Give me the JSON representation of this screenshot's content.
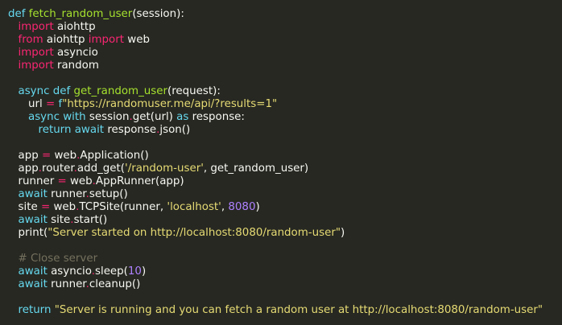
{
  "editor": {
    "theme_colors": {
      "background": "#272822",
      "keyword": "#f92672",
      "storage": "#66d9ef",
      "function": "#a6e22e",
      "string": "#e6db74",
      "number": "#ae81ff",
      "comment": "#75715e",
      "text": "#f8f8f2"
    },
    "lines": [
      {
        "indent": 0,
        "tokens": [
          [
            "st",
            "def"
          ],
          [
            "tx",
            " "
          ],
          [
            "fn",
            "fetch_random_user"
          ],
          [
            "tx",
            "(session):"
          ]
        ]
      },
      {
        "indent": 1,
        "tokens": [
          [
            "kw",
            "import"
          ],
          [
            "tx",
            " aiohttp"
          ]
        ]
      },
      {
        "indent": 1,
        "tokens": [
          [
            "kw",
            "from"
          ],
          [
            "tx",
            " aiohttp "
          ],
          [
            "kw",
            "import"
          ],
          [
            "tx",
            " web"
          ]
        ]
      },
      {
        "indent": 1,
        "tokens": [
          [
            "kw",
            "import"
          ],
          [
            "tx",
            " asyncio"
          ]
        ]
      },
      {
        "indent": 1,
        "tokens": [
          [
            "kw",
            "import"
          ],
          [
            "tx",
            " random"
          ]
        ]
      },
      {
        "indent": 0,
        "tokens": []
      },
      {
        "indent": 1,
        "tokens": [
          [
            "st",
            "async"
          ],
          [
            "tx",
            " "
          ],
          [
            "st",
            "def"
          ],
          [
            "tx",
            " "
          ],
          [
            "fn",
            "get_random_user"
          ],
          [
            "tx",
            "(request):"
          ]
        ]
      },
      {
        "indent": 2,
        "tokens": [
          [
            "tx",
            "url "
          ],
          [
            "op",
            "="
          ],
          [
            "tx",
            " "
          ],
          [
            "st",
            "f"
          ],
          [
            "str",
            "\"https://randomuser.me/api/?results=1\""
          ]
        ]
      },
      {
        "indent": 2,
        "tokens": [
          [
            "st",
            "async"
          ],
          [
            "tx",
            " "
          ],
          [
            "st",
            "with"
          ],
          [
            "tx",
            " session"
          ],
          [
            "op",
            "."
          ],
          [
            "tx",
            "get(url) "
          ],
          [
            "st",
            "as"
          ],
          [
            "tx",
            " response:"
          ]
        ]
      },
      {
        "indent": 3,
        "tokens": [
          [
            "st",
            "return"
          ],
          [
            "tx",
            " "
          ],
          [
            "st",
            "await"
          ],
          [
            "tx",
            " response"
          ],
          [
            "op",
            "."
          ],
          [
            "tx",
            "json()"
          ]
        ]
      },
      {
        "indent": 0,
        "tokens": []
      },
      {
        "indent": 1,
        "tokens": [
          [
            "tx",
            "app "
          ],
          [
            "op",
            "="
          ],
          [
            "tx",
            " web"
          ],
          [
            "op",
            "."
          ],
          [
            "tx",
            "Application()"
          ]
        ]
      },
      {
        "indent": 1,
        "tokens": [
          [
            "tx",
            "app"
          ],
          [
            "op",
            "."
          ],
          [
            "tx",
            "router"
          ],
          [
            "op",
            "."
          ],
          [
            "tx",
            "add_get("
          ],
          [
            "str",
            "'/random-user'"
          ],
          [
            "tx",
            ", get_random_user)"
          ]
        ]
      },
      {
        "indent": 1,
        "tokens": [
          [
            "tx",
            "runner "
          ],
          [
            "op",
            "="
          ],
          [
            "tx",
            " web"
          ],
          [
            "op",
            "."
          ],
          [
            "tx",
            "AppRunner(app)"
          ]
        ]
      },
      {
        "indent": 1,
        "tokens": [
          [
            "st",
            "await"
          ],
          [
            "tx",
            " runner"
          ],
          [
            "op",
            "."
          ],
          [
            "tx",
            "setup()"
          ]
        ]
      },
      {
        "indent": 1,
        "tokens": [
          [
            "tx",
            "site "
          ],
          [
            "op",
            "="
          ],
          [
            "tx",
            " web"
          ],
          [
            "op",
            "."
          ],
          [
            "tx",
            "TCPSite(runner, "
          ],
          [
            "str",
            "'localhost'"
          ],
          [
            "tx",
            ", "
          ],
          [
            "num",
            "8080"
          ],
          [
            "tx",
            ")"
          ]
        ]
      },
      {
        "indent": 1,
        "tokens": [
          [
            "st",
            "await"
          ],
          [
            "tx",
            " site"
          ],
          [
            "op",
            "."
          ],
          [
            "tx",
            "start()"
          ]
        ]
      },
      {
        "indent": 1,
        "tokens": [
          [
            "tx",
            "print("
          ],
          [
            "str",
            "\"Server started on http://localhost:8080/random-user\""
          ],
          [
            "tx",
            ")"
          ]
        ]
      },
      {
        "indent": 0,
        "tokens": []
      },
      {
        "indent": 1,
        "tokens": [
          [
            "cm",
            "# Close server"
          ]
        ]
      },
      {
        "indent": 1,
        "tokens": [
          [
            "st",
            "await"
          ],
          [
            "tx",
            " asyncio"
          ],
          [
            "op",
            "."
          ],
          [
            "tx",
            "sleep("
          ],
          [
            "num",
            "10"
          ],
          [
            "tx",
            ")"
          ]
        ]
      },
      {
        "indent": 1,
        "tokens": [
          [
            "st",
            "await"
          ],
          [
            "tx",
            " runner"
          ],
          [
            "op",
            "."
          ],
          [
            "tx",
            "cleanup()"
          ]
        ]
      },
      {
        "indent": 0,
        "tokens": []
      },
      {
        "indent": 1,
        "tokens": [
          [
            "st",
            "return"
          ],
          [
            "tx",
            " "
          ],
          [
            "str",
            "\"Server is running and you can fetch a random user at http://localhost:8080/random-user\""
          ]
        ]
      }
    ]
  }
}
